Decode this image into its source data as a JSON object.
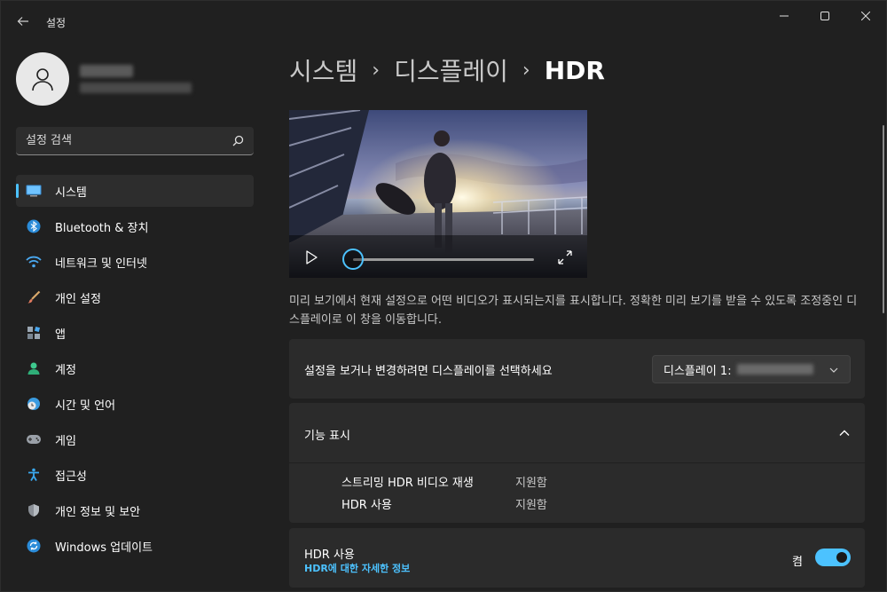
{
  "window": {
    "title": "설정"
  },
  "sidebar": {
    "search_placeholder": "설정 검색",
    "items": [
      {
        "label": "시스템",
        "icon": "monitor-icon",
        "active": true
      },
      {
        "label": "Bluetooth & 장치",
        "icon": "bluetooth-icon"
      },
      {
        "label": "네트워크 및 인터넷",
        "icon": "wifi-icon"
      },
      {
        "label": "개인 설정",
        "icon": "paintbrush-icon"
      },
      {
        "label": "앱",
        "icon": "apps-icon"
      },
      {
        "label": "계정",
        "icon": "person-icon"
      },
      {
        "label": "시간 및 언어",
        "icon": "globe-clock-icon"
      },
      {
        "label": "게임",
        "icon": "gamepad-icon"
      },
      {
        "label": "접근성",
        "icon": "accessibility-icon"
      },
      {
        "label": "개인 정보 및 보안",
        "icon": "shield-icon"
      },
      {
        "label": "Windows 업데이트",
        "icon": "update-icon"
      }
    ]
  },
  "main": {
    "breadcrumb": [
      "시스템",
      "디스플레이",
      "HDR"
    ],
    "preview_description": "미리 보기에서 현재 설정으로 어떤 비디오가 표시되는지를 표시합니다. 정확한 미리 보기를 받을 수 있도록 조정중인 디스플레이로 이 창을 이동합니다.",
    "video": {
      "progress": 0
    },
    "display_select": {
      "label": "설정을 보거나 변경하려면 디스플레이를 선택하세요",
      "selected": "디스플레이 1:"
    },
    "capabilities": {
      "title": "기능 표시",
      "rows": [
        {
          "name": "스트리밍 HDR 비디오 재생",
          "value": "지원함"
        },
        {
          "name": "HDR 사용",
          "value": "지원함"
        }
      ]
    },
    "hdr": {
      "label": "HDR 사용",
      "link": "HDR에 대한 자세한 정보",
      "state": "켬",
      "enabled": true
    }
  },
  "colors": {
    "accent": "#4cc2ff",
    "background": "#202020",
    "card": "#2b2b2b"
  }
}
